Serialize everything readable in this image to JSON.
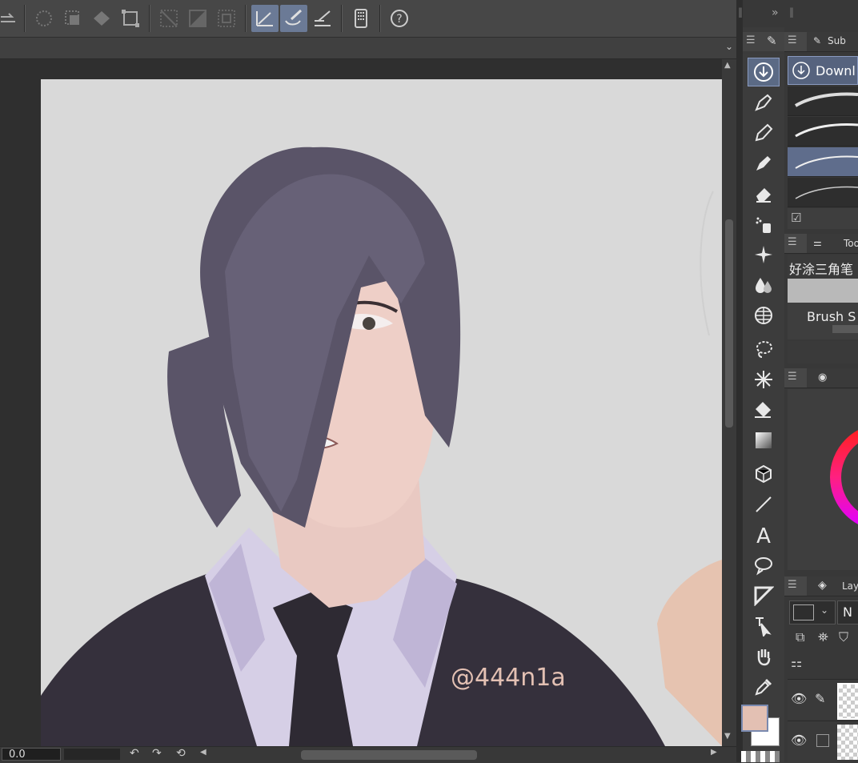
{
  "canvas": {
    "watermark": "@444n1a",
    "zoom_value": "0.0"
  },
  "sub_tool_panel": {
    "tab_label": "Sub",
    "download_label": "Downl"
  },
  "tool_property_panel": {
    "tab_label": "Too",
    "brush_name": "好涂三角笔",
    "brush_size_label": "Brush S"
  },
  "layer_panel": {
    "tab_label": "Lay",
    "blend_mode": "N"
  },
  "colors": {
    "main_color": "#e3c0b3",
    "sub_color": "#ffffff",
    "accent": "#6b7a96",
    "canvas_bg": "#d9d9d9"
  },
  "icons": {
    "toolbar": [
      "transfer-icon",
      "selection-all-icon",
      "selection-clear-icon",
      "fill-selection-icon",
      "transform-icon",
      "deselect-icon",
      "invert-selection-icon",
      "selection-border-icon",
      "stabilizer-line-icon",
      "brush-stroke-icon",
      "pen-angle-icon",
      "tablet-icon",
      "help-icon"
    ],
    "tools": [
      "download-icon",
      "pen-icon",
      "pencil-icon",
      "marker-icon",
      "eraser-icon",
      "airbrush-icon",
      "sparkle-icon",
      "blend-icon",
      "mesh-icon",
      "lasso-icon",
      "auto-select-icon",
      "fill-bucket-icon",
      "gradient-icon",
      "3d-object-icon",
      "line-icon",
      "text-icon",
      "balloon-icon",
      "ruler-icon",
      "operation-icon",
      "hand-icon",
      "eyedropper-icon"
    ]
  }
}
